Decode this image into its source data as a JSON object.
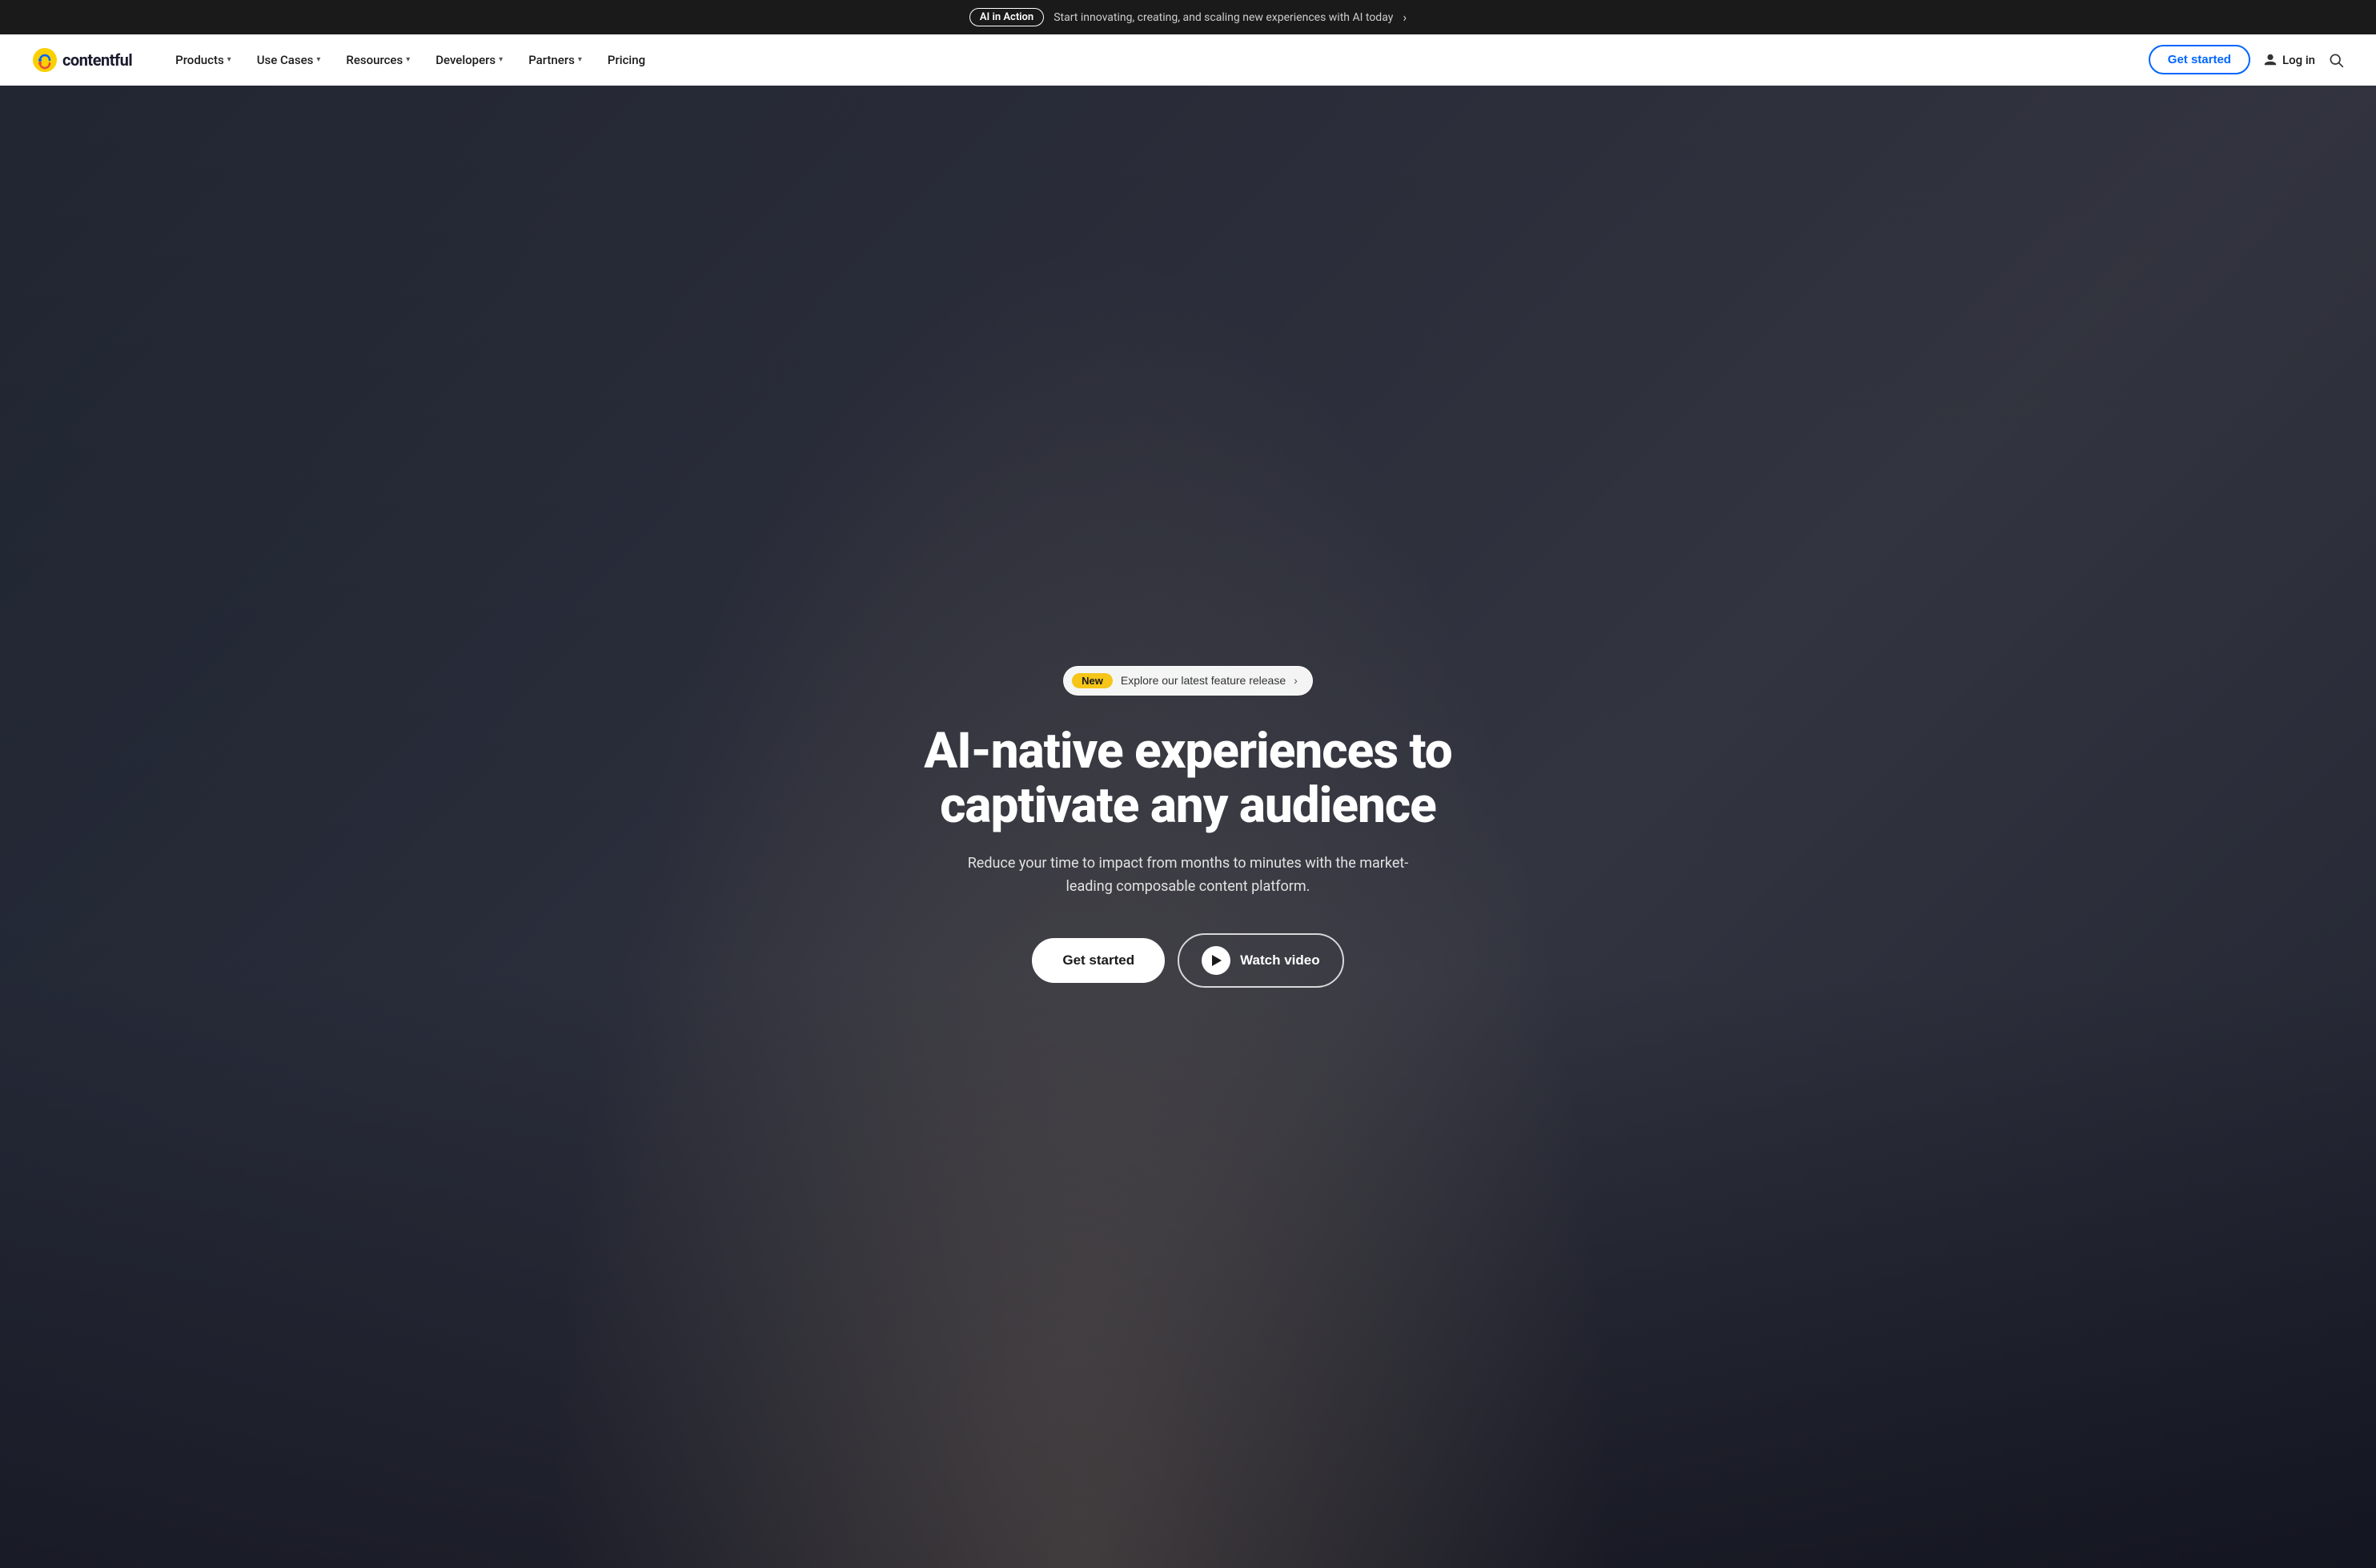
{
  "banner": {
    "badge_label": "AI in Action",
    "text": "Start innovating, creating, and scaling new experiences with AI today",
    "arrow": "›"
  },
  "navbar": {
    "logo_text": "contentful",
    "nav_items": [
      {
        "label": "Products",
        "has_dropdown": true
      },
      {
        "label": "Use Cases",
        "has_dropdown": true
      },
      {
        "label": "Resources",
        "has_dropdown": true
      },
      {
        "label": "Developers",
        "has_dropdown": true
      },
      {
        "label": "Partners",
        "has_dropdown": true
      },
      {
        "label": "Pricing",
        "has_dropdown": false
      }
    ],
    "get_started_label": "Get started",
    "login_label": "Log in"
  },
  "hero": {
    "new_badge": "New",
    "feature_text": "Explore our latest feature release",
    "feature_arrow": "›",
    "title_line1": "AI-native experiences to",
    "title_line2": "captivate any audience",
    "subtitle": "Reduce your time to impact from months to minutes with the market-leading composable content platform.",
    "cta_primary": "Get started",
    "cta_video": "Watch video",
    "play_icon": "▶"
  }
}
